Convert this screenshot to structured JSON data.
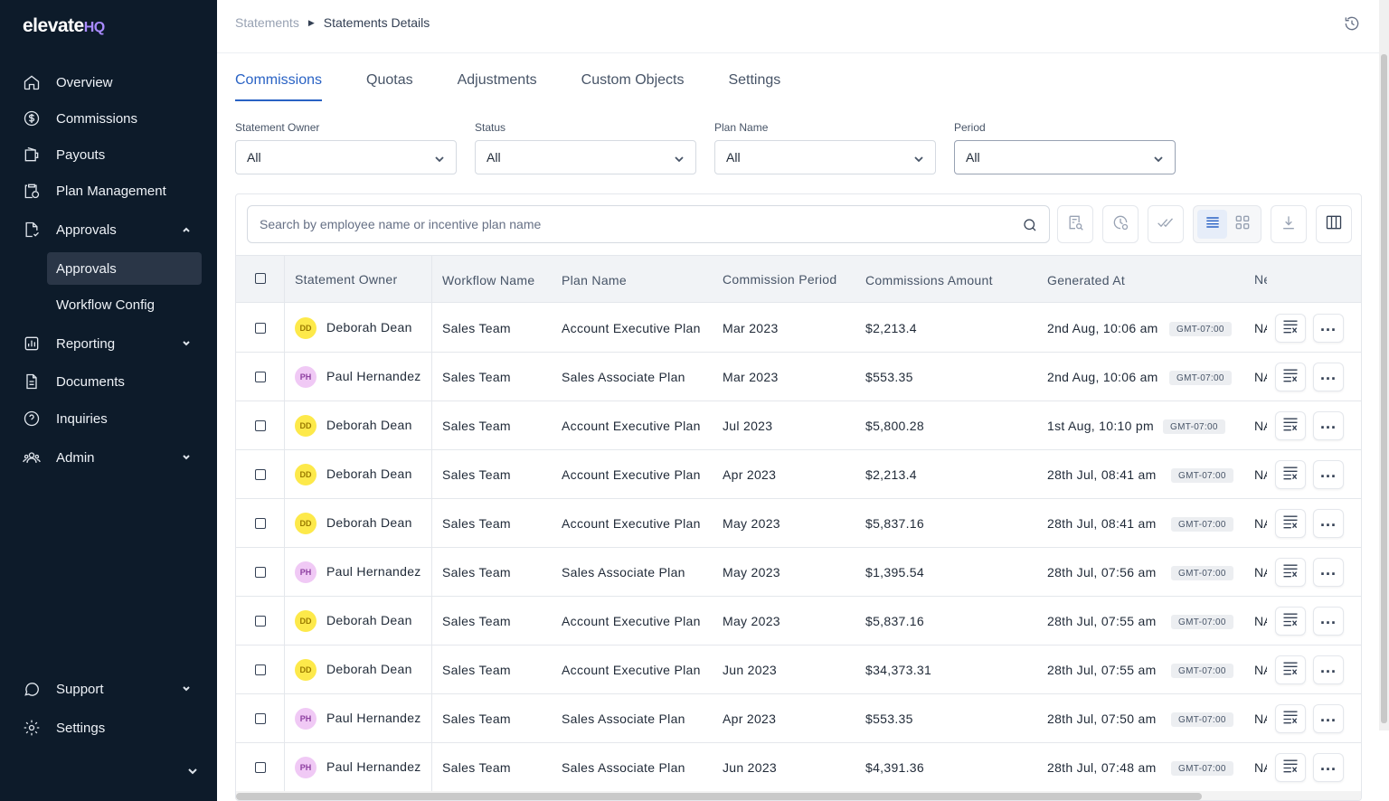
{
  "brand": {
    "name": "elevate",
    "suffix": "HQ"
  },
  "sidebar": {
    "items": [
      {
        "label": "Overview",
        "icon": "home-icon"
      },
      {
        "label": "Commissions",
        "icon": "dollar-circle-icon"
      },
      {
        "label": "Payouts",
        "icon": "wallet-icon"
      },
      {
        "label": "Plan Management",
        "icon": "clipboard-dollar-icon"
      },
      {
        "label": "Approvals",
        "icon": "document-check-icon",
        "expanded": true
      },
      {
        "label": "Reporting",
        "icon": "bar-chart-icon"
      },
      {
        "label": "Documents",
        "icon": "document-icon"
      },
      {
        "label": "Inquiries",
        "icon": "question-circle-icon"
      },
      {
        "label": "Admin",
        "icon": "users-icon"
      }
    ],
    "approvals_sub": [
      "Approvals",
      "Workflow Config"
    ],
    "bottom": [
      {
        "label": "Support",
        "icon": "chat-icon"
      },
      {
        "label": "Settings",
        "icon": "gear-icon"
      }
    ]
  },
  "breadcrumb": {
    "root": "Statements",
    "current": "Statements Details"
  },
  "tabs": [
    "Commissions",
    "Quotas",
    "Adjustments",
    "Custom Objects",
    "Settings"
  ],
  "filters": [
    {
      "label": "Statement Owner",
      "value": "All"
    },
    {
      "label": "Status",
      "value": "All"
    },
    {
      "label": "Plan Name",
      "value": "All"
    },
    {
      "label": "Period",
      "value": "All"
    }
  ],
  "search": {
    "placeholder": "Search by employee name or incentive plan name"
  },
  "table": {
    "headers": [
      "Statement Owner",
      "Workflow Name",
      "Plan Name",
      "Commission Period",
      "Commissions Amount",
      "Generated At",
      "Ne"
    ],
    "rows": [
      {
        "initials": "DD",
        "owner": "Deborah Dean",
        "workflow": "Sales Team",
        "plan": "Account Executive Plan",
        "period": "Mar 2023",
        "amount": "$2,213.4",
        "generated": "2nd Aug, 10:06 am",
        "tz": "GMT-07:00",
        "next": "NA"
      },
      {
        "initials": "PH",
        "owner": "Paul Hernandez",
        "workflow": "Sales Team",
        "plan": "Sales Associate Plan",
        "period": "Mar 2023",
        "amount": "$553.35",
        "generated": "2nd Aug, 10:06 am",
        "tz": "GMT-07:00",
        "next": "NA"
      },
      {
        "initials": "DD",
        "owner": "Deborah Dean",
        "workflow": "Sales Team",
        "plan": "Account Executive Plan",
        "period": "Jul 2023",
        "amount": "$5,800.28",
        "generated": "1st Aug, 10:10 pm",
        "tz": "GMT-07:00",
        "next": "NA"
      },
      {
        "initials": "DD",
        "owner": "Deborah Dean",
        "workflow": "Sales Team",
        "plan": "Account Executive Plan",
        "period": "Apr 2023",
        "amount": "$2,213.4",
        "generated": "28th Jul, 08:41 am",
        "tz": "GMT-07:00",
        "next": "NA"
      },
      {
        "initials": "DD",
        "owner": "Deborah Dean",
        "workflow": "Sales Team",
        "plan": "Account Executive Plan",
        "period": "May 2023",
        "amount": "$5,837.16",
        "generated": "28th Jul, 08:41 am",
        "tz": "GMT-07:00",
        "next": "NA"
      },
      {
        "initials": "PH",
        "owner": "Paul Hernandez",
        "workflow": "Sales Team",
        "plan": "Sales Associate Plan",
        "period": "May 2023",
        "amount": "$1,395.54",
        "generated": "28th Jul, 07:56 am",
        "tz": "GMT-07:00",
        "next": "NA"
      },
      {
        "initials": "DD",
        "owner": "Deborah Dean",
        "workflow": "Sales Team",
        "plan": "Account Executive Plan",
        "period": "May 2023",
        "amount": "$5,837.16",
        "generated": "28th Jul, 07:55 am",
        "tz": "GMT-07:00",
        "next": "NA"
      },
      {
        "initials": "DD",
        "owner": "Deborah Dean",
        "workflow": "Sales Team",
        "plan": "Account Executive Plan",
        "period": "Jun 2023",
        "amount": "$34,373.31",
        "generated": "28th Jul, 07:55 am",
        "tz": "GMT-07:00",
        "next": "NA"
      },
      {
        "initials": "PH",
        "owner": "Paul Hernandez",
        "workflow": "Sales Team",
        "plan": "Sales Associate Plan",
        "period": "Apr 2023",
        "amount": "$553.35",
        "generated": "28th Jul, 07:50 am",
        "tz": "GMT-07:00",
        "next": "NA"
      },
      {
        "initials": "PH",
        "owner": "Paul Hernandez",
        "workflow": "Sales Team",
        "plan": "Sales Associate Plan",
        "period": "Jun 2023",
        "amount": "$4,391.36",
        "generated": "28th Jul, 07:48 am",
        "tz": "GMT-07:00",
        "next": "NA"
      }
    ]
  },
  "colors": {
    "sidebar_bg": "#0d1b2a",
    "accent": "#2962c4",
    "brand_suffix": "#a98bff"
  }
}
